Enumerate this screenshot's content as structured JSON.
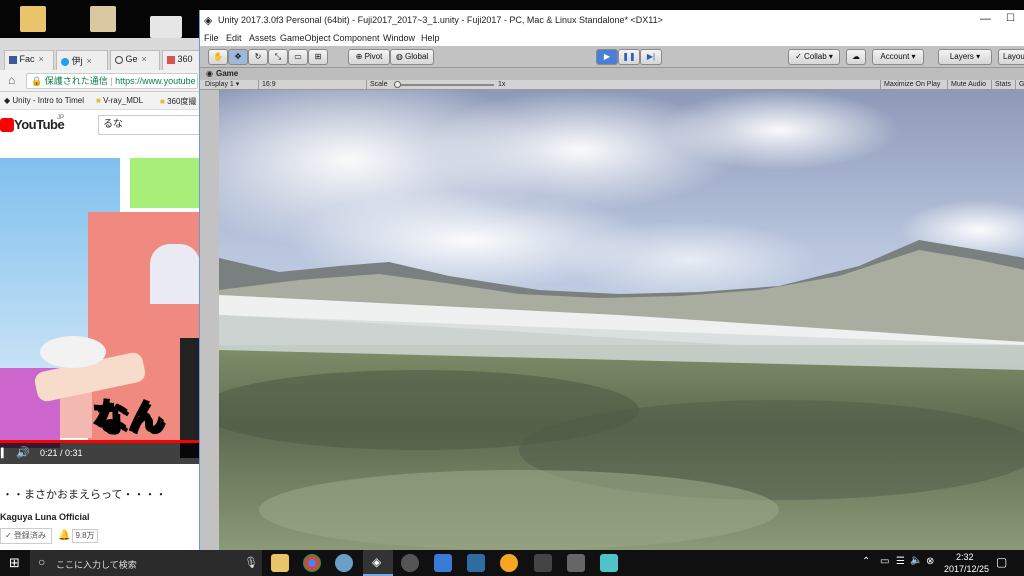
{
  "chrome": {
    "tabs": [
      {
        "label": "Fac",
        "icon": "facebook-icon",
        "color": "#3b5998"
      },
      {
        "label": "伊j",
        "icon": "twitter-icon",
        "color": "#1da1f2"
      },
      {
        "label": "Ge",
        "icon": "globe-icon",
        "color": "#444444"
      },
      {
        "label": "360",
        "icon": "bookmark-icon",
        "color": "#d9534f"
      }
    ],
    "secure_label": "保護された通信",
    "url": "https://www.youtube",
    "bookmarks": [
      {
        "label": "Unity - Intro to Timel"
      },
      {
        "label": "V-ray_MDL"
      },
      {
        "label": "360度撮"
      }
    ],
    "youtube": {
      "logo": "YouTube",
      "logo_suffix": "JP",
      "search_value": "るな",
      "time": "0:21 / 0:31",
      "overlay_text": "なん",
      "video_title": "・・まさかおまえらって・・・・",
      "channel": "Kaguya Luna Official",
      "subscribed_label": "登録済み",
      "subscriber_count": "9.8万"
    }
  },
  "unity": {
    "title": "Unity 2017.3.0f3 Personal (64bit) - Fuji2017_2017~3_1.unity - Fuji2017 - PC, Mac & Linux Standalone* <DX11>",
    "menu": [
      "File",
      "Edit",
      "Assets",
      "GameObject",
      "Component",
      "Window",
      "Help"
    ],
    "toolbar": {
      "pivot_label": "Pivot",
      "global_label": "Global",
      "collab_label": "Collab",
      "account_label": "Account",
      "layers_label": "Layers",
      "layout_label": "Layou"
    },
    "game": {
      "tab_label": "Game",
      "display_label": "Display 1",
      "aspect_label": "16:9",
      "scale_label": "Scale",
      "scale_value": "1x",
      "maximize_label": "Maximize On Play",
      "mute_label": "Mute Audio",
      "stats_label": "Stats",
      "gizmos_label": "Giz"
    }
  },
  "taskbar": {
    "search_placeholder": "ここに入力して検索",
    "time": "2:32",
    "date": "2017/12/25"
  },
  "colors": {
    "play_active": "#4a7fd6",
    "unity_bg": "#c2c2c2",
    "taskbar": "#101010"
  }
}
